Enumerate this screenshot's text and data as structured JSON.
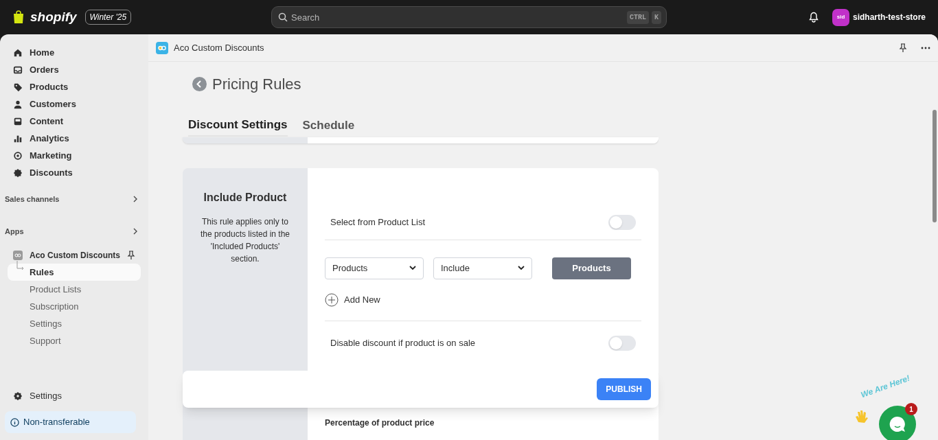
{
  "topbar": {
    "brand": "shopify",
    "edition": "Winter '25",
    "search": {
      "placeholder": "Search"
    },
    "shortcut_keys": [
      "CTRL",
      "K"
    ],
    "store": {
      "avatar": "sid",
      "name": "sidharth-test-store"
    }
  },
  "sidebar": {
    "items": [
      {
        "label": "Home",
        "selected": false
      },
      {
        "label": "Orders",
        "selected": false
      },
      {
        "label": "Products",
        "selected": false
      },
      {
        "label": "Customers",
        "selected": false
      },
      {
        "label": "Content",
        "selected": false
      },
      {
        "label": "Analytics",
        "selected": false
      },
      {
        "label": "Marketing",
        "selected": false
      },
      {
        "label": "Discounts",
        "selected": false
      }
    ],
    "sections": [
      {
        "label": "Sales channels"
      },
      {
        "label": "Apps"
      }
    ],
    "app": {
      "label": "Aco Custom Discounts",
      "subitems": [
        {
          "label": "Rules",
          "selected": true
        },
        {
          "label": "Product Lists",
          "selected": false
        },
        {
          "label": "Subscription",
          "selected": false
        },
        {
          "label": "Settings",
          "selected": false
        },
        {
          "label": "Support",
          "selected": false
        }
      ]
    },
    "settings": "Settings",
    "plan_notice": "Non-transferable"
  },
  "app_header": {
    "title": "Aco Custom Discounts"
  },
  "page": {
    "title": "Pricing Rules",
    "tabs": [
      {
        "label": "Discount Settings",
        "selected": true
      },
      {
        "label": "Schedule",
        "selected": false
      }
    ],
    "include_card": {
      "title": "Include Product",
      "description": "This rule applies only to the products listed in the 'Included Products' section.",
      "toggle_rows": [
        {
          "label": "Select from Product List",
          "on": false
        }
      ],
      "selects": [
        "Products",
        "Include"
      ],
      "products_button": "Products",
      "add_new": "Add New",
      "sale_toggle": {
        "label": "Disable discount if product is on sale",
        "on": false
      }
    },
    "publish_button": "PUBLISH",
    "next_card_label": "Percentage of product price"
  },
  "chat_widget": {
    "caption": "We Are Here!",
    "badge": "1"
  }
}
